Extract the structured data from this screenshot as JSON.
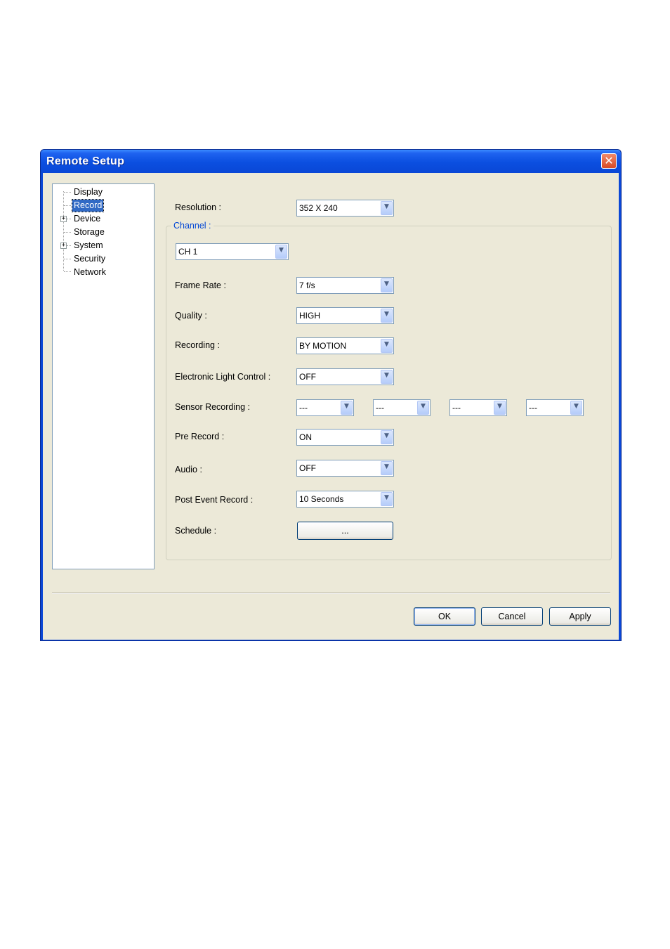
{
  "window": {
    "title": "Remote Setup"
  },
  "tree": {
    "items": [
      {
        "label": "Display",
        "selected": false,
        "expandable": false
      },
      {
        "label": "Record",
        "selected": true,
        "expandable": false
      },
      {
        "label": "Device",
        "selected": false,
        "expandable": true
      },
      {
        "label": "Storage",
        "selected": false,
        "expandable": false
      },
      {
        "label": "System",
        "selected": false,
        "expandable": true
      },
      {
        "label": "Security",
        "selected": false,
        "expandable": false
      },
      {
        "label": "Network",
        "selected": false,
        "expandable": false
      }
    ],
    "expand_glyph": "+"
  },
  "form": {
    "resolution_label": "Resolution :",
    "resolution_value": "352 X 240",
    "channel_group_title": "Channel :",
    "channel_value": "CH 1",
    "frame_rate_label": "Frame Rate :",
    "frame_rate_value": "7 f/s",
    "quality_label": "Quality :",
    "quality_value": "HIGH",
    "recording_label": "Recording :",
    "recording_value": "BY MOTION",
    "elc_label": "Electronic Light Control :",
    "elc_value": "OFF",
    "sensor_label": "Sensor Recording :",
    "sensor_values": [
      "---",
      "---",
      "---",
      "---"
    ],
    "pre_record_label": "Pre Record :",
    "pre_record_value": "ON",
    "audio_label": "Audio :",
    "audio_value": "OFF",
    "post_event_label": "Post Event Record :",
    "post_event_value": "10 Seconds",
    "schedule_label": "Schedule :",
    "schedule_button": "..."
  },
  "buttons": {
    "ok": "OK",
    "cancel": "Cancel",
    "apply": "Apply"
  },
  "icons": {
    "close": "close-icon",
    "dropdown": "chevron-down-icon",
    "expand": "plus-box-icon"
  },
  "colors": {
    "titlebar": "#0a47d6",
    "dialog_bg": "#ece9d8",
    "selection": "#316ac5",
    "group_title": "#0046d5"
  }
}
